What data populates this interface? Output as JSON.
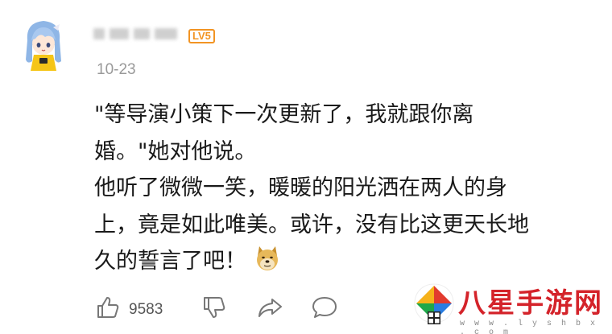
{
  "comment": {
    "user": {
      "level_badge": "LV5"
    },
    "date": "10-23",
    "lines": [
      "\"等导演小策下一次更新了，我就跟你离",
      "婚。\"她对他说。",
      "他听了微微一笑，暖暖的阳光洒在两人的身",
      "上，竟是如此唯美。或许，没有比这更天长地",
      "久的誓言了吧！"
    ],
    "emoji": "doge-emoji",
    "actions": {
      "like_count": "9583",
      "icons": [
        "thumbs-up-icon",
        "thumbs-down-icon",
        "share-icon",
        "comment-icon"
      ]
    }
  },
  "watermark": {
    "title": "八星手游网",
    "url": "w w w . l y s h b x . c o m"
  },
  "colors": {
    "badge": "#f29423",
    "date": "#999999",
    "watermark_red": "#d4232a"
  }
}
